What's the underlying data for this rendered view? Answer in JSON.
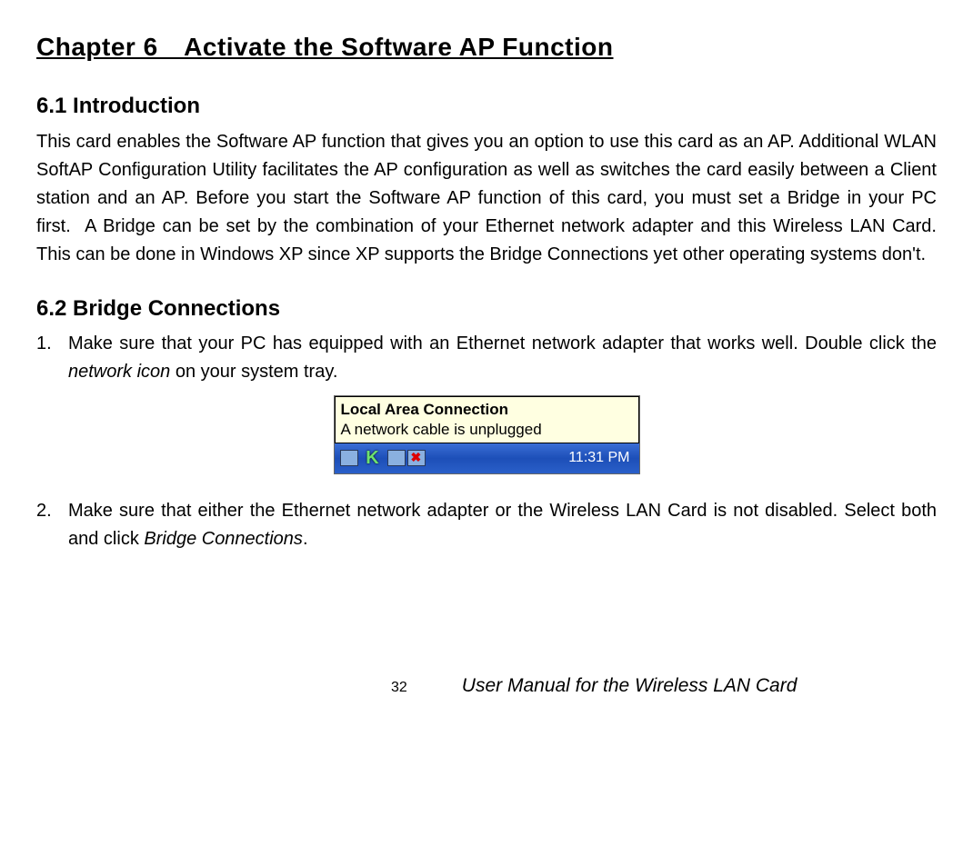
{
  "chapter": {
    "title": "Chapter 6 Activate the Software AP Function"
  },
  "section1": {
    "title": "6.1 Introduction",
    "body": "This card enables the Software AP function that gives you an option to use this card as an AP. Additional WLAN SoftAP Configuration Utility facilitates the AP configuration as well as switches the card easily between a Client station and an AP. Before you start the Software AP function of this card, you must set a Bridge in your PC first.  A Bridge can be set by the combination of your Ethernet network adapter and this Wireless LAN Card. This can be done in Windows XP since XP supports the Bridge Connections yet other operating systems don't."
  },
  "section2": {
    "title": "6.2 Bridge Connections",
    "item1": {
      "num": "1.",
      "pre": "Make sure that your PC has equipped with an Ethernet network adapter that works well. Double click the ",
      "italic": "network icon",
      "post": " on your system tray."
    },
    "item2": {
      "num": "2.",
      "pre": "Make sure that either the Ethernet network adapter or the Wireless LAN Card is not disabled. Select both and click ",
      "italic": "Bridge Connections",
      "post": "."
    }
  },
  "systray": {
    "tooltip_title": "Local Area Connection",
    "tooltip_msg": "A network cable is unplugged",
    "time": "11:31 PM"
  },
  "footer": {
    "page": "32",
    "doc_title": "User Manual for the Wireless LAN Card"
  }
}
